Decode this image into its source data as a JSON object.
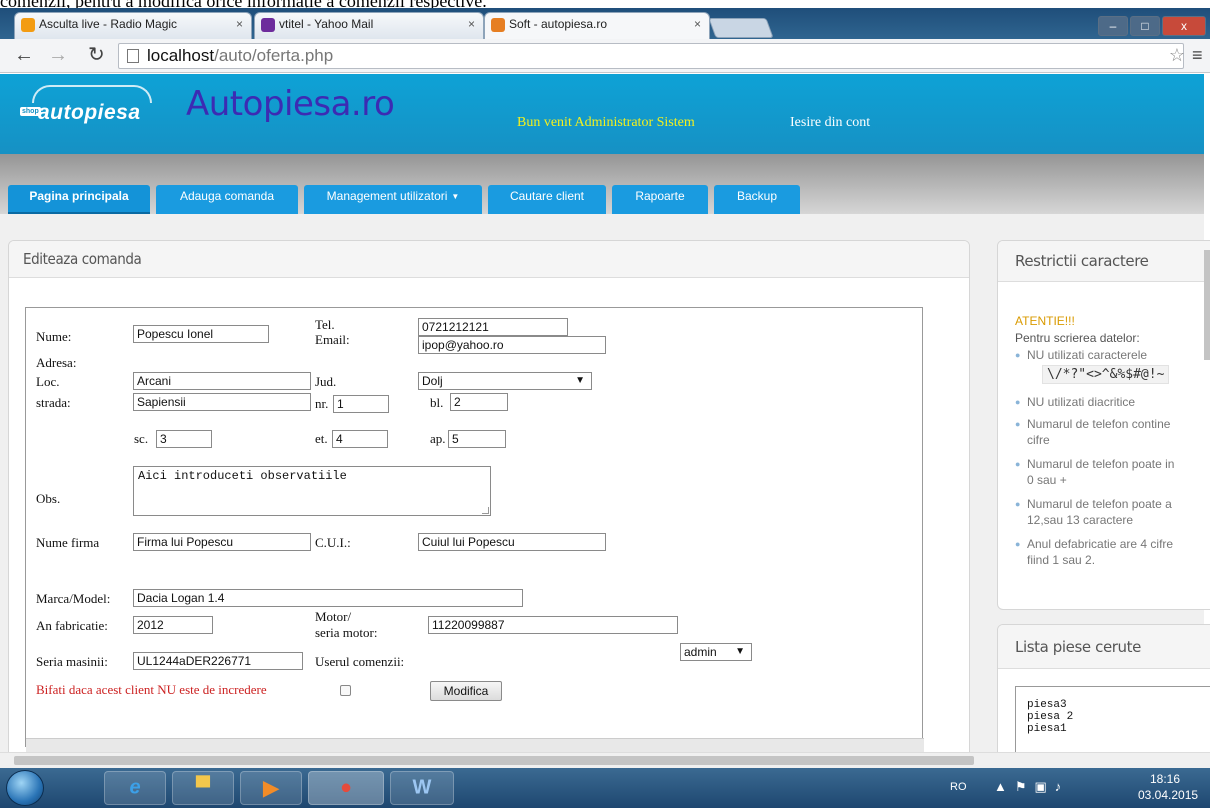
{
  "doc_caption": "comenzii, pentru a modifica orice informație a comenzii respective.",
  "browser": {
    "tabs": [
      {
        "title": "Asculta live - Radio Magic"
      },
      {
        "title": "vtitel - Yahoo Mail"
      },
      {
        "title": "Soft - autopiesa.ro"
      }
    ],
    "url_host": "localhost",
    "url_path": "/auto/oferta.php",
    "window_buttons": {
      "min": "–",
      "max": "□",
      "close": "x"
    }
  },
  "header": {
    "logo_text": "autopiesa",
    "logo_shop": "shop",
    "site_title": "Autopiesa.ro",
    "welcome": "Bun venit Administrator Sistem",
    "logout": "Iesire din cont"
  },
  "nav": {
    "tabs": [
      "Pagina principala",
      "Adauga comanda",
      "Management utilizatori",
      "Cautare client",
      "Rapoarte",
      "Backup"
    ]
  },
  "form": {
    "panel_title": "Editeaza comanda",
    "labels": {
      "nume": "Nume:",
      "tel": "Tel.",
      "email": "Email:",
      "adresa": "Adresa:",
      "loc": "Loc.",
      "jud": "Jud.",
      "strada": "strada:",
      "nr": "nr.",
      "bl": "bl.",
      "sc": "sc.",
      "et": "et.",
      "ap": "ap.",
      "obs": "Obs.",
      "nume_firma": "Nume firma",
      "cui": "C.U.I.:",
      "marca": "Marca/Model:",
      "an": "An fabricatie:",
      "motor1": "Motor/",
      "motor2": "seria motor:",
      "seria": "Seria masinii:",
      "userul": "Userul comenzii:",
      "untrusted": "Bifati daca acest client NU este de incredere"
    },
    "values": {
      "nume": "Popescu Ionel",
      "tel": "0721212121",
      "email": "ipop@yahoo.ro",
      "loc": "Arcani",
      "jud": "Dolj",
      "strada": "Sapiensii",
      "nr": "1",
      "bl": "2",
      "sc": "3",
      "et": "4",
      "ap": "5",
      "obs": "Aici introduceti observatiile",
      "nume_firma": "Firma lui Popescu",
      "cui": "Cuiul lui Popescu",
      "marca": "Dacia Logan 1.4",
      "an": "2012",
      "motor": "11220099887",
      "seria": "UL1244aDER226771",
      "userul": "admin"
    },
    "submit": "Modifica"
  },
  "sidebar": {
    "restrictions_title": "Restrictii caractere",
    "warning": "ATENTIE!!!",
    "intro": "Pentru scrierea datelor:",
    "rules": [
      {
        "line1": "NU utilizati caracterele",
        "line2": ""
      },
      {
        "line1": "NU utilizati diacritice",
        "line2": ""
      },
      {
        "line1": "Numarul de telefon contine",
        "line2": "cifre"
      },
      {
        "line1": "Numarul de telefon poate in",
        "line2": "0 sau +"
      },
      {
        "line1": "Numarul de telefon poate a",
        "line2": "12,sau 13 caractere"
      },
      {
        "line1": "Anul defabricatie are 4 cifre",
        "line2": "fiind 1 sau 2."
      }
    ],
    "forbidden_chars": "\\/*?\"<>^&%$#@!~",
    "parts_title": "Lista piese cerute",
    "parts": [
      "piesa3",
      "piesa 2",
      "piesa1"
    ]
  },
  "taskbar": {
    "lang": "RO",
    "time": "18:16",
    "date": "03.04.2015"
  },
  "colors": {
    "header_blue": "#1691c4",
    "nav_blue": "#1a9be0",
    "title_purple": "#3c2bb3",
    "welcome_yellow": "#f4f01e",
    "warning_orange": "#d99a00",
    "untrusted_red": "#cc2222"
  }
}
